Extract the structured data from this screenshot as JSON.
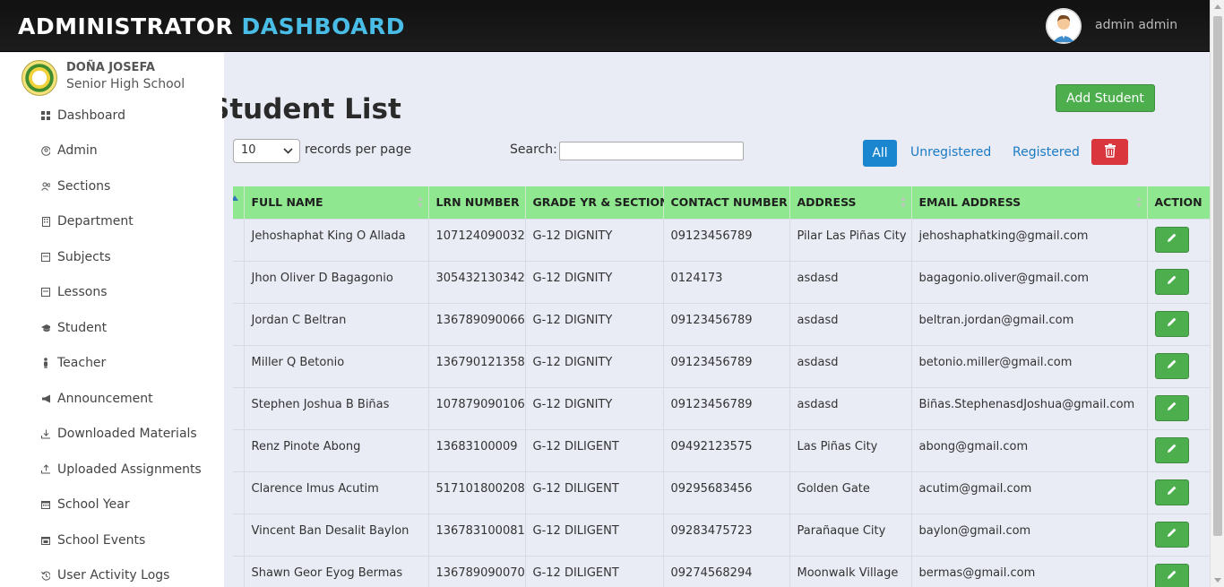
{
  "header": {
    "brand_main": "ADMINISTRATOR",
    "brand_accent": "DASHBOARD",
    "user_name": "admin admin"
  },
  "sidebar": {
    "school_line1": "DOÑA JOSEFA",
    "school_line2": "Senior High School",
    "items": [
      {
        "label": "Dashboard",
        "icon": "grid-icon"
      },
      {
        "label": "Admin",
        "icon": "user-circle-icon"
      },
      {
        "label": "Sections",
        "icon": "users-icon"
      },
      {
        "label": "Department",
        "icon": "building-icon"
      },
      {
        "label": "Subjects",
        "icon": "book-icon"
      },
      {
        "label": "Lessons",
        "icon": "book-icon"
      },
      {
        "label": "Student",
        "icon": "graduation-cap-icon"
      },
      {
        "label": "Teacher",
        "icon": "person-icon"
      },
      {
        "label": "Announcement",
        "icon": "megaphone-icon"
      },
      {
        "label": "Downloaded Materials",
        "icon": "download-icon"
      },
      {
        "label": "Uploaded Assignments",
        "icon": "upload-icon"
      },
      {
        "label": "School Year",
        "icon": "calendar-icon"
      },
      {
        "label": "School Events",
        "icon": "calendar-check-icon"
      },
      {
        "label": "User Activity Logs",
        "icon": "history-icon"
      }
    ]
  },
  "main": {
    "title": "Student List",
    "add_button": "Add Student",
    "length_value": "10",
    "length_label": "records per page",
    "search_label": "Search:",
    "search_value": "",
    "filters": {
      "all": "All",
      "unregistered": "Unregistered",
      "registered": "Registered"
    }
  },
  "table": {
    "headers": [
      "",
      "FULL NAME",
      "LRN NUMBER",
      "GRADE YR & SECTION",
      "CONTACT NUMBER",
      "ADDRESS",
      "EMAIL ADDRESS",
      "ACTION"
    ],
    "rows": [
      [
        "Jehoshaphat King O Allada",
        "107124090032",
        "G-12 DIGNITY",
        "09123456789",
        "Pilar Las Piñas City",
        "jehoshaphatking@gmail.com"
      ],
      [
        "Jhon Oliver D Bagagonio",
        "305432130342",
        "G-12 DIGNITY",
        "0124173",
        "asdasd",
        "bagagonio.oliver@gmail.com"
      ],
      [
        "Jordan C Beltran",
        "136789090066",
        "G-12 DIGNITY",
        "09123456789",
        "asdasd",
        "beltran.jordan@gmail.com"
      ],
      [
        "Miller Q Betonio",
        "136790121358",
        "G-12 DIGNITY",
        "09123456789",
        "asdasd",
        "betonio.miller@gmail.com"
      ],
      [
        "Stephen Joshua B Biñas",
        "107879090106",
        "G-12 DIGNITY",
        "09123456789",
        "asdasd",
        "Biñas.StephenasdJoshua@gmail.com"
      ],
      [
        "Renz Pinote Abong",
        "13683100009",
        "G-12 DILIGENT",
        "09492123575",
        "Las Piñas City",
        "abong@gmail.com"
      ],
      [
        "Clarence Imus Acutim",
        "517101800208",
        "G-12 DILIGENT",
        "09295683456",
        "Golden Gate",
        "acutim@gmail.com"
      ],
      [
        "Vincent Ban Desalit Baylon",
        "136783100081",
        "G-12 DILIGENT",
        "09283475723",
        "Parañaque City",
        "baylon@gmail.com"
      ],
      [
        "Shawn Geor Eyog Bermas",
        "136789090070",
        "G-12 DILIGENT",
        "09274568294",
        "Moonwalk Village",
        "bermas@gmail.com"
      ]
    ]
  },
  "colors": {
    "header_bg": "#151515",
    "brand_accent": "#49bde6",
    "table_header": "#8fe88f",
    "success": "#4cae4c",
    "primary": "#1a86d0",
    "danger": "#d9363e",
    "page_bg": "#e9ebf5"
  }
}
